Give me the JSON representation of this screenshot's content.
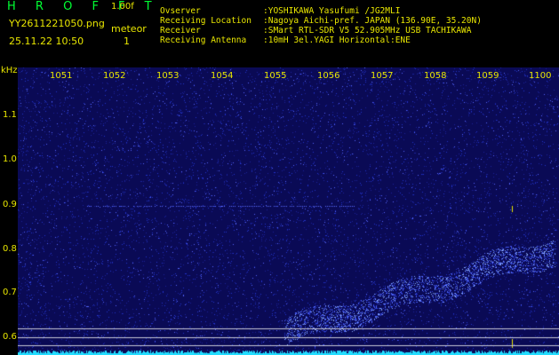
{
  "header": {
    "app_name": "H R O F F T",
    "version": "1.00f",
    "filename": "YY2611221050.png",
    "datetime": "25.11.22 10:50",
    "meteor_label": "meteor",
    "meteor_count": "1",
    "info": [
      {
        "key": "Ovserver",
        "value": ":YOSHIKAWA Yasufumi /JG2MLI"
      },
      {
        "key": "Receiving Location",
        "value": ":Nagoya Aichi-pref. JAPAN (136.90E, 35.20N)"
      },
      {
        "key": "Receiver",
        "value": ":SMart RTL-SDR V5 52.905MHz USB TACHIKAWA"
      },
      {
        "key": "Receiving Antenna",
        "value": ":10mH 3el.YAGI Horizontal:ENE"
      }
    ]
  },
  "plot": {
    "freq_unit": "kHz",
    "time_labels": [
      "1051",
      "1052",
      "1053",
      "1054",
      "1055",
      "1056",
      "1057",
      "1058",
      "1059",
      "1100"
    ],
    "freq_ticks": [
      "1.1",
      "1.0",
      "0.9",
      "0.8",
      "0.7",
      "0.6"
    ],
    "colors": {
      "background": "#0a0a55",
      "noise": "#3344ff",
      "signal": "#66aaff",
      "floor": "#22ddff",
      "text": "#e8e600"
    }
  }
}
